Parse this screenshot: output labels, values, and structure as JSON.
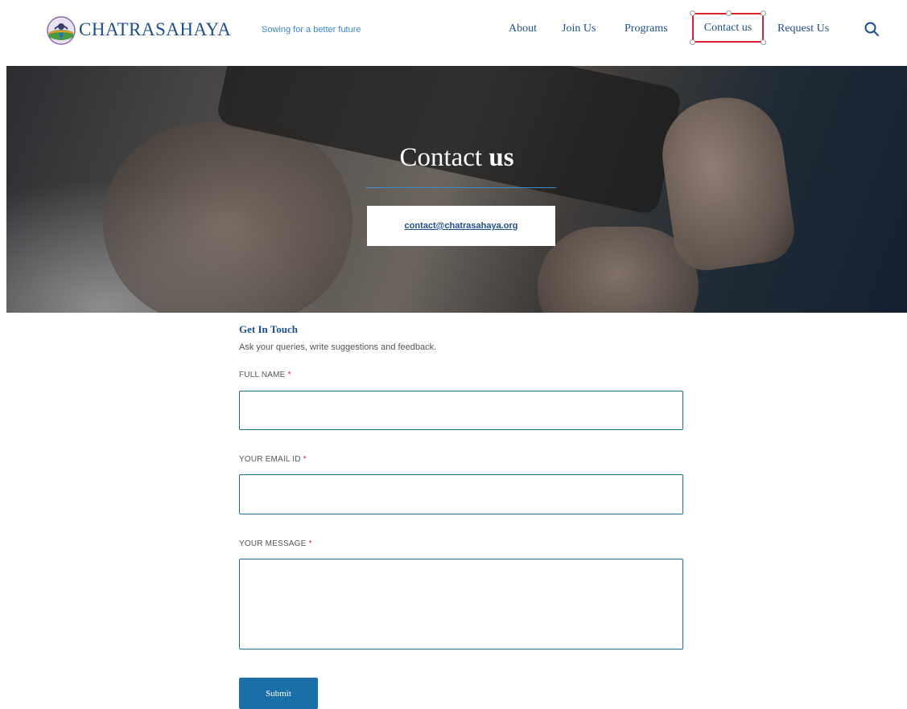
{
  "header": {
    "brand": "CHATRASAHAYA",
    "tagline": "Sowing for a better future",
    "nav": {
      "about": "About",
      "join": "Join Us",
      "programs": "Programs",
      "contact": "Contact us",
      "request": "Request Us"
    }
  },
  "hero": {
    "title_normal": "Contact ",
    "title_bold": "us",
    "email": "contact@chatrasahaya.org"
  },
  "form": {
    "title": "Get In Touch",
    "subtitle": "Ask your queries, write suggestions and feedback.",
    "name_label": "FULL NAME",
    "email_label": "YOUR EMAIL ID",
    "message_label": "YOUR MESSAGE",
    "required_mark": "*",
    "name_value": "",
    "email_value": "",
    "message_value": "",
    "submit_label": "Submit"
  },
  "colors": {
    "brand_blue": "#1f4f88",
    "accent_blue": "#1a6fa8",
    "highlight_red": "#d8222d"
  },
  "icons": {
    "logo": "chatrasahaya-logo-icon",
    "search": "search-icon"
  }
}
